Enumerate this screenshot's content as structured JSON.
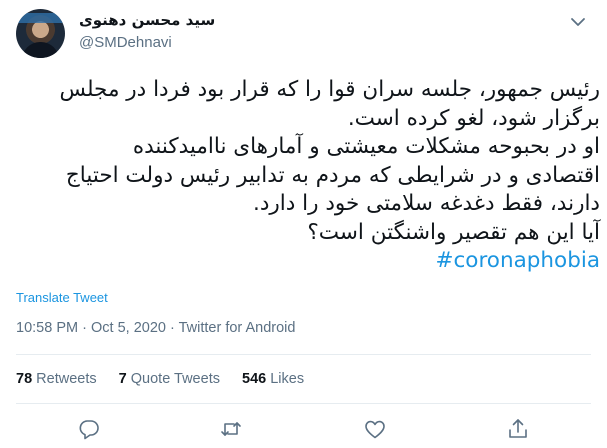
{
  "author": {
    "display_name": "سید محسن دهنوی",
    "handle": "@SMDehnavi"
  },
  "tweet": {
    "lines": [
      "رئیس جمهور، جلسه سران قوا را که قرار بود فردا در مجلس",
      "برگزار شود، لغو کرده است.",
      "او در بحبوحه مشکلات معیشتی و آمارهای ناامیدکننده",
      "اقتصادی و در شرایطی که مردم به تدابیر رئیس دولت احتیاج",
      "دارند، فقط دغدغه سلامتی خود را دارد.",
      "آیا این هم تقصیر واشنگتن است؟"
    ],
    "hashtag": "#coronaphobia",
    "translate_label": "Translate Tweet",
    "time": "10:58 PM",
    "date": "Oct 5, 2020",
    "source": "Twitter for Android",
    "separator": "·"
  },
  "stats": {
    "retweets_count": "78",
    "retweets_label": "Retweets",
    "quotes_count": "7",
    "quotes_label": "Quote Tweets",
    "likes_count": "546",
    "likes_label": "Likes"
  },
  "colors": {
    "accent": "#1b95e0",
    "secondary_text": "#5b7083",
    "divider": "#e6ecf0"
  },
  "icons": [
    "chevron-down-icon",
    "reply-icon",
    "retweet-icon",
    "like-icon",
    "share-icon"
  ]
}
